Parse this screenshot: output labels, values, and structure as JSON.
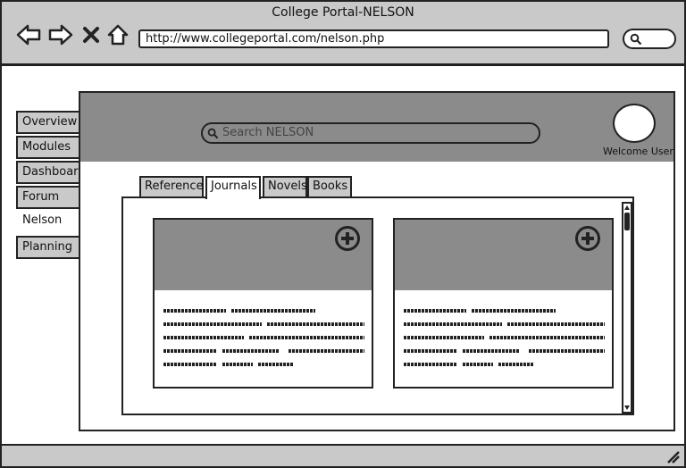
{
  "window": {
    "title": "College Portal-NELSON"
  },
  "toolbar": {
    "back_icon": "left-arrow-icon",
    "forward_icon": "right-arrow-icon",
    "stop_icon": "close-icon",
    "home_icon": "home-icon",
    "url": "http://www.collegeportal.com/nelson.php",
    "search_icon": "search-icon"
  },
  "sidebar": {
    "items": [
      {
        "label": "Overview"
      },
      {
        "label": "Modules"
      },
      {
        "label": "Dashboard"
      },
      {
        "label": "Forum"
      },
      {
        "label": "Nelson",
        "active": true
      },
      {
        "label": "Planning"
      }
    ]
  },
  "header": {
    "search_placeholder": "Search NELSON",
    "welcome": "Welcome User"
  },
  "tabs": [
    {
      "label": "Reference"
    },
    {
      "label": "Journals",
      "active": true
    },
    {
      "label": "Novels"
    },
    {
      "label": "Books"
    }
  ],
  "cards": [
    {
      "image": "placeholder-image",
      "action_icon": "plus-circle-icon"
    },
    {
      "image": "placeholder-image",
      "action_icon": "plus-circle-icon"
    }
  ],
  "colors": {
    "chrome": "#c9c9c9",
    "header": "#8b8b8b",
    "stroke": "#222222"
  }
}
